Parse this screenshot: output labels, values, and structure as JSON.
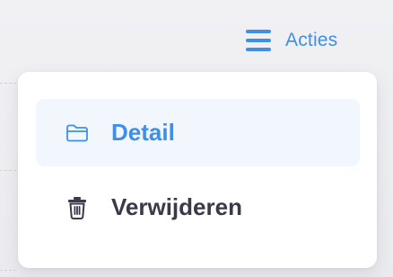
{
  "header": {
    "actions_button": {
      "icon": "menu-lines-icon",
      "label": "Acties"
    }
  },
  "actions_menu": {
    "items": [
      {
        "label": "Detail",
        "icon": "folder-icon",
        "active": true
      },
      {
        "label": "Verwijderen",
        "icon": "trash-icon",
        "active": false
      }
    ]
  },
  "colors": {
    "accent": "#3f8fe6",
    "item_text": "#3a3a48",
    "active_background": "#f1f7fd",
    "menu_background": "#ffffff",
    "page_background": "#ececf0"
  }
}
